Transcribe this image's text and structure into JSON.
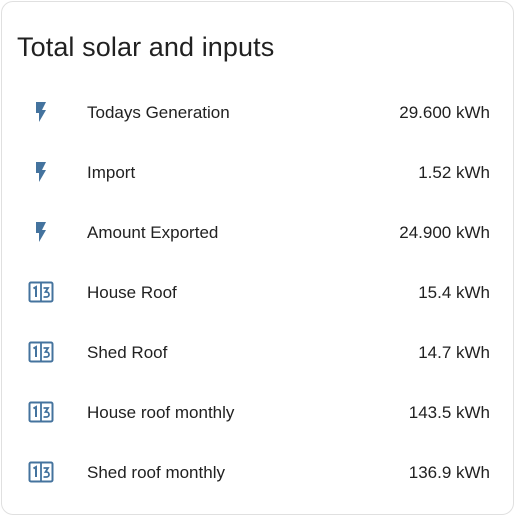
{
  "card": {
    "title": "Total solar and inputs",
    "icon_color": "#44739e",
    "rows": [
      {
        "name": "Todays Generation",
        "value": "29.600 kWh",
        "icon": "flash-icon"
      },
      {
        "name": "Import",
        "value": "1.52 kWh",
        "icon": "flash-icon"
      },
      {
        "name": "Amount Exported",
        "value": "24.900 kWh",
        "icon": "flash-icon"
      },
      {
        "name": "House Roof",
        "value": "15.4 kWh",
        "icon": "counter-icon"
      },
      {
        "name": "Shed Roof",
        "value": "14.7 kWh",
        "icon": "counter-icon"
      },
      {
        "name": "House roof monthly",
        "value": "143.5 kWh",
        "icon": "counter-icon"
      },
      {
        "name": "Shed roof monthly",
        "value": "136.9 kWh",
        "icon": "counter-icon"
      }
    ]
  }
}
